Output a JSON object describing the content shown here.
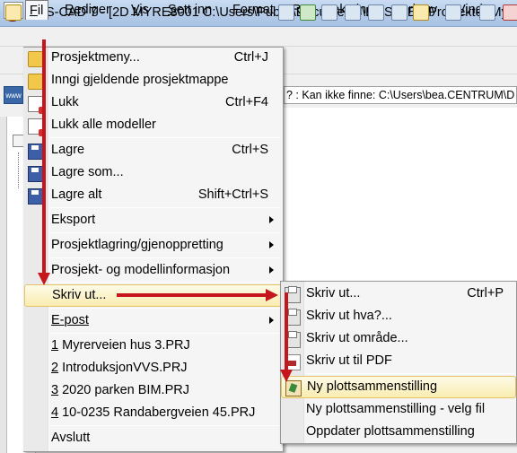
{
  "window": {
    "title": "DDS-CAD 7 - [2D  MYRE8001  C:\\Users\\Public\\Documents\\DDS\\MEP\\Prosjekter\\My"
  },
  "menubar": {
    "items": [
      {
        "label": "Fil",
        "underline": "F",
        "rest": "il"
      },
      {
        "label": "Rediger",
        "underline": "R",
        "rest": "ediger"
      },
      {
        "label": "Vis",
        "underline": "V",
        "rest": "is"
      },
      {
        "label": "Sett inn",
        "underline": "S",
        "rest": "ett inn"
      },
      {
        "label": "Format",
        "pre": "F",
        "underline": "o",
        "rest": "rmat"
      },
      {
        "label": "Rør",
        "pre": "",
        "underline": "",
        "rest": "Rør"
      },
      {
        "label": "Teksting",
        "underline": "T",
        "rest": "eksting"
      },
      {
        "label": "Verktøy",
        "underline": "V",
        "rest": "erktøy"
      },
      {
        "label": "Vindu",
        "underline": "V",
        "rest": "indu"
      },
      {
        "label": "H",
        "underline": "H",
        "rest": ""
      }
    ]
  },
  "status": {
    "text": "? : Kan ikke finne: C:\\Users\\bea.CENTRUM\\D"
  },
  "www_icon": "www",
  "fil_menu": {
    "items": [
      {
        "label": "Prosjektmeny...",
        "shortcut": "Ctrl+J",
        "icon": "project-menu-icon"
      },
      {
        "label": "Inngi gjeldende prosjektmappe",
        "shortcut": "",
        "icon": "folder-icon"
      },
      {
        "label": "Lukk",
        "shortcut": "Ctrl+F4",
        "icon": "close-document-icon"
      },
      {
        "label": "Lukk alle modeller",
        "shortcut": "",
        "icon": "close-all-icon"
      },
      {
        "label": "Lagre",
        "shortcut": "Ctrl+S",
        "icon": "save-icon"
      },
      {
        "label": "Lagre som...",
        "shortcut": "",
        "icon": "save-as-icon"
      },
      {
        "label": "Lagre alt",
        "shortcut": "Shift+Ctrl+S",
        "icon": "save-all-icon"
      },
      {
        "label": "Eksport",
        "submenu": true
      },
      {
        "label": "Prosjektlagring/gjenoppretting",
        "submenu": true
      },
      {
        "label": "Prosjekt- og modellinformasjon",
        "submenu": true
      },
      {
        "label": "Skriv ut...",
        "submenu": true,
        "highlighted": true
      },
      {
        "label": "E-post",
        "submenu": true
      },
      {
        "label": "1 Myrerveien hus 3.PRJ",
        "num": "1",
        "name": "Myrerveien hus 3.PRJ"
      },
      {
        "label": "2 IntroduksjonVVS.PRJ",
        "num": "2",
        "name": "IntroduksjonVVS.PRJ"
      },
      {
        "label": "3 2020 parken BIM.PRJ",
        "num": "3",
        "name": "2020 parken BIM.PRJ"
      },
      {
        "label": "4 10-0235 Randabergveien 45.PRJ",
        "num": "4",
        "name": "10-0235 Randabergveien 45.PRJ"
      },
      {
        "label": "Avslutt"
      }
    ]
  },
  "skriv_ut_submenu": {
    "items": [
      {
        "label": "Skriv ut...",
        "shortcut": "Ctrl+P",
        "icon": "printer-icon"
      },
      {
        "label": "Skriv ut hva?...",
        "shortcut": "",
        "icon": "print-what-icon"
      },
      {
        "label": "Skriv ut område...",
        "shortcut": "",
        "icon": "print-area-icon"
      },
      {
        "label": "Skriv ut til PDF",
        "shortcut": "",
        "icon": "pdf-icon"
      },
      {
        "label": "Ny plottsammenstilling",
        "shortcut": "",
        "icon": "plot-layout-icon",
        "highlighted": true
      },
      {
        "label": "Ny plottsammenstilling - velg fil",
        "shortcut": ""
      },
      {
        "label": "Oppdater plottsammenstilling",
        "shortcut": ""
      }
    ]
  },
  "colors": {
    "annotation_arrow": "#c4161c",
    "highlight_bg": "#f9ecb0",
    "highlight_border": "#e5c365"
  }
}
